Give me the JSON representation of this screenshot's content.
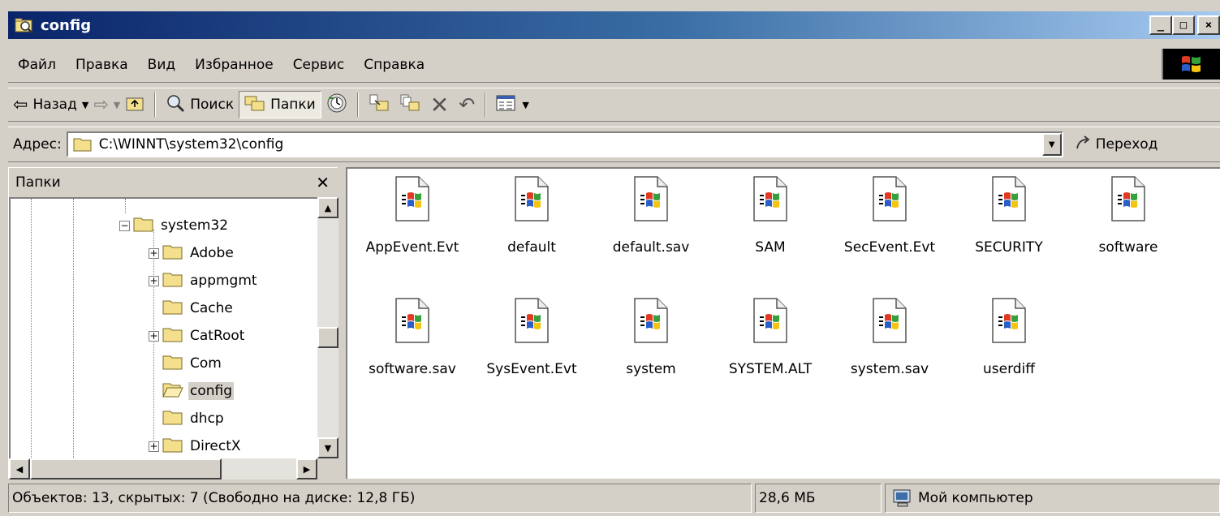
{
  "window": {
    "title": "config",
    "buttons": {
      "minimize": "_",
      "maximize": "□",
      "close": "×"
    }
  },
  "menu": [
    "Файл",
    "Правка",
    "Вид",
    "Избранное",
    "Сервис",
    "Справка"
  ],
  "toolbar": {
    "back_label": "Назад",
    "search_label": "Поиск",
    "folders_label": "Папки"
  },
  "address": {
    "label": "Адрес:",
    "path": "C:\\WINNT\\system32\\config",
    "go_label": "Переход"
  },
  "folders_pane": {
    "title": "Папки",
    "items": [
      {
        "label": "system32",
        "toggle": "−"
      },
      {
        "label": "Adobe",
        "toggle": "+"
      },
      {
        "label": "appmgmt",
        "toggle": "+"
      },
      {
        "label": "Cache",
        "toggle": ""
      },
      {
        "label": "CatRoot",
        "toggle": "+"
      },
      {
        "label": "Com",
        "toggle": ""
      },
      {
        "label": "config",
        "toggle": "",
        "selected": true,
        "open": true
      },
      {
        "label": "dhcp",
        "toggle": ""
      },
      {
        "label": "DirectX",
        "toggle": "+"
      }
    ]
  },
  "files": [
    "AppEvent.Evt",
    "default",
    "default.sav",
    "SAM",
    "SecEvent.Evt",
    "SECURITY",
    "software",
    "software.sav",
    "SysEvent.Evt",
    "system",
    "SYSTEM.ALT",
    "system.sav",
    "userdiff"
  ],
  "status": {
    "objects": "Объектов: 13, скрытых: 7 (Свободно на диске: 12,8 ГБ)",
    "size": "28,6 МБ",
    "location": "Мой компьютер"
  },
  "colors": {
    "title_gradient_start": "#0a246a",
    "title_gradient_end": "#a6caf0",
    "face": "#d4d0c8",
    "folder": "#f4e08c"
  }
}
